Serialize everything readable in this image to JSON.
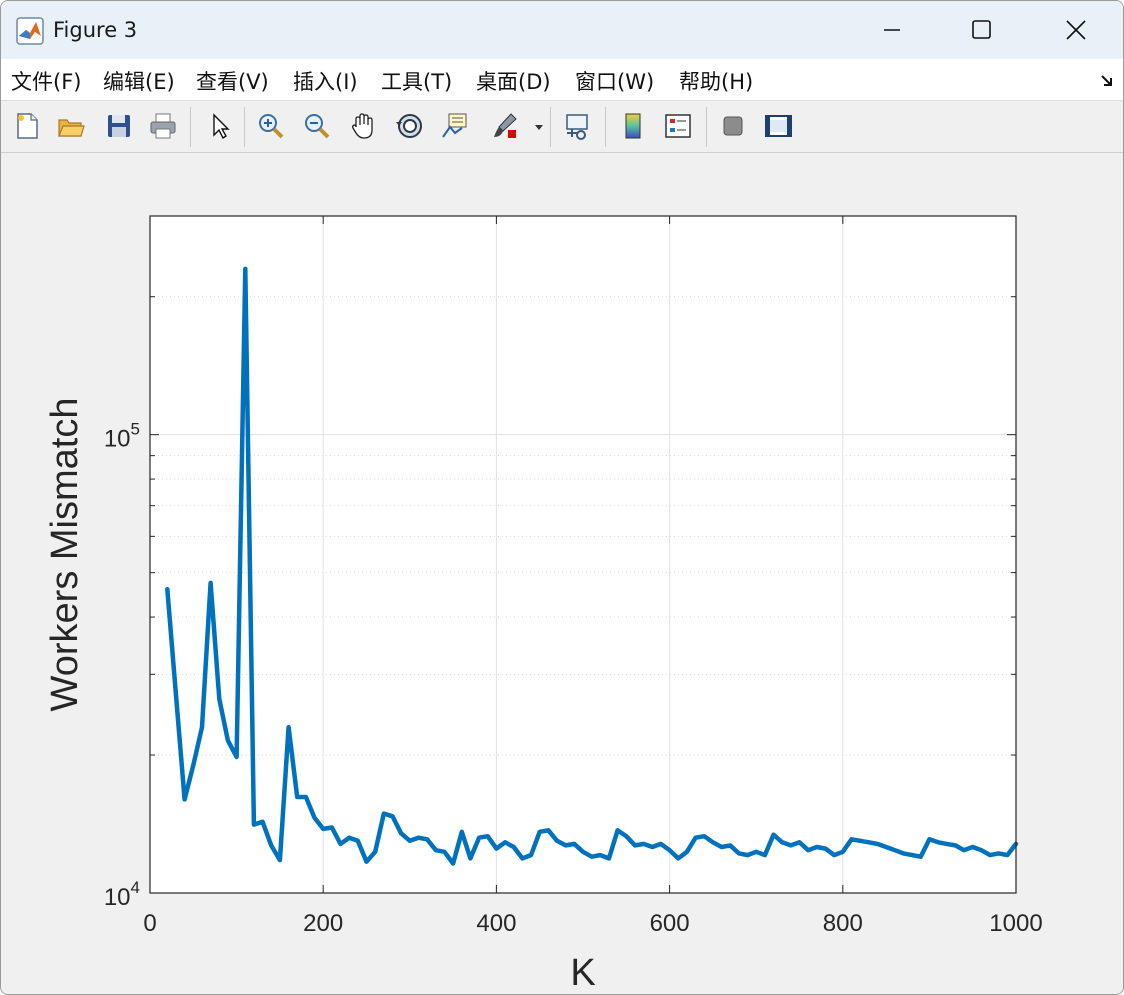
{
  "window": {
    "title": "Figure 3"
  },
  "menu": {
    "items": [
      {
        "label": "文件(F)"
      },
      {
        "label": "编辑(E)"
      },
      {
        "label": "查看(V)"
      },
      {
        "label": "插入(I)"
      },
      {
        "label": "工具(T)"
      },
      {
        "label": "桌面(D)"
      },
      {
        "label": "窗口(W)"
      },
      {
        "label": "帮助(H)"
      }
    ]
  },
  "colors": {
    "line": "#0072BD",
    "titlebar": "#e8f1f8",
    "figure_bg": "#f0f0f0"
  },
  "chart_data": {
    "type": "line",
    "title": "",
    "xlabel": "K",
    "ylabel": "Workers Mismatch",
    "xlim": [
      0,
      1000
    ],
    "ylim": [
      10000,
      300000
    ],
    "yscale": "log",
    "grid": true,
    "x_ticks": [
      "0",
      "200",
      "400",
      "600",
      "800",
      "1000"
    ],
    "y_ticks": [
      {
        "base": "10",
        "exp": "4"
      },
      {
        "base": "10",
        "exp": "5"
      }
    ],
    "series": [
      {
        "x": [
          20,
          30,
          40,
          50,
          60,
          70,
          80,
          90,
          100,
          110,
          120,
          130,
          140,
          150,
          160,
          170,
          180,
          190,
          200,
          210,
          220,
          230,
          240,
          250,
          260,
          270,
          280,
          290,
          300,
          310,
          320,
          330,
          340,
          350,
          360,
          370,
          380,
          390,
          400,
          410,
          420,
          430,
          440,
          450,
          460,
          470,
          480,
          490,
          500,
          510,
          520,
          530,
          540,
          550,
          560,
          570,
          580,
          590,
          600,
          610,
          620,
          630,
          640,
          650,
          660,
          670,
          680,
          690,
          700,
          710,
          720,
          730,
          740,
          750,
          760,
          770,
          780,
          790,
          800,
          810,
          820,
          830,
          840,
          850,
          860,
          870,
          880,
          890,
          900,
          910,
          920,
          930,
          940,
          950,
          960,
          970,
          980,
          990,
          1000
        ],
        "y": [
          46000,
          27000,
          16000,
          19000,
          23000,
          47500,
          26500,
          21500,
          19800,
          230000,
          14100,
          14300,
          12700,
          11800,
          23000,
          16200,
          16200,
          14600,
          13800,
          13900,
          12800,
          13200,
          13000,
          11700,
          12300,
          14900,
          14700,
          13500,
          13000,
          13200,
          13100,
          12400,
          12300,
          11600,
          13600,
          11900,
          13200,
          13300,
          12500,
          12900,
          12600,
          11900,
          12100,
          13600,
          13700,
          13000,
          12700,
          12800,
          12300,
          12000,
          12100,
          11900,
          13700,
          13300,
          12700,
          12800,
          12600,
          12800,
          12400,
          11900,
          12300,
          13200,
          13300,
          12900,
          12600,
          12700,
          12200,
          12100,
          12300,
          12100,
          13400,
          12900,
          12700,
          12900,
          12400,
          12600,
          12500,
          12100,
          12300,
          13100,
          13000,
          12900,
          12800,
          12600,
          12400,
          12200,
          12100,
          12000,
          13100,
          12900,
          12800,
          12700,
          12400,
          12600,
          12400,
          12100,
          12200,
          12100,
          12800
        ]
      }
    ]
  }
}
